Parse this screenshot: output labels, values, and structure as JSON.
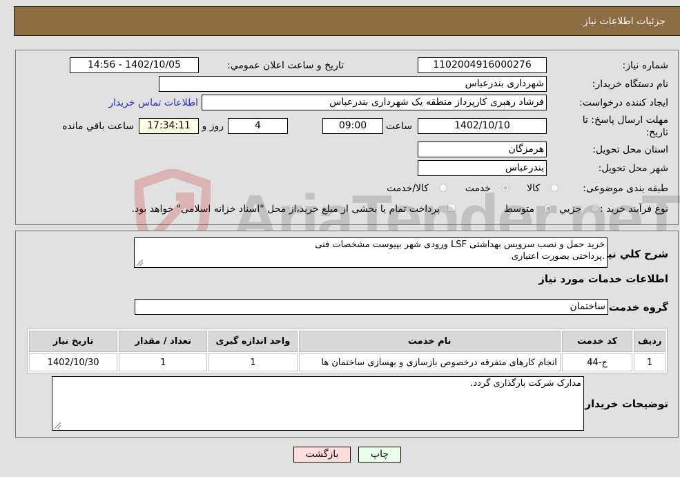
{
  "header": {
    "title": "جزئیات اطلاعات نیاز"
  },
  "form": {
    "need_number": {
      "label": "شماره نیاز:",
      "value": "1102004916000276"
    },
    "announce_datetime": {
      "label": "تاریخ و ساعت اعلان عمومي:",
      "value": "1402/10/05 - 14:56"
    },
    "buyer_org": {
      "label": "نام دستگاه خریدار:",
      "value": "شهرداری بندرعباس"
    },
    "requester": {
      "label": "ایجاد کننده درخواست:",
      "value": "فرشاد رهبری کارپرداز منطقه یک شهرداری بندرعباس"
    },
    "buyer_contact_link": "اطلاعات تماس خریدار",
    "deadline": {
      "label_line1": "مهلت ارسال پاسخ: تا",
      "label_line2": "تاریخ:",
      "date": "1402/10/10",
      "time_label": "ساعت",
      "time": "09:00",
      "days": "4",
      "days_label": "روز و",
      "remaining": "17:34:11",
      "remaining_label": "ساعت باقي مانده"
    },
    "delivery_province": {
      "label": "استان محل تحویل:",
      "value": "هرمزگان"
    },
    "delivery_city": {
      "label": "شهر محل تحویل:",
      "value": "بندرعباس"
    },
    "category": {
      "label": "طبقه بندی موضوعی:",
      "options": [
        "کالا",
        "خدمت",
        "کالا/خدمت"
      ],
      "selected": "خدمت"
    },
    "purchase_type": {
      "label": "نوع فرآیند خرید :",
      "options": [
        "جزیي",
        "متوسط"
      ],
      "selected": "متوسط",
      "treasury_checkbox_label": "پرداخت تمام یا بخشی از مبلغ خرید،از محل \"اسناد خزانه اسلامی\" خواهد بود.",
      "treasury_checked": false
    }
  },
  "description": {
    "label": "شرح کلي نیاز:",
    "value_line1": "خرید حمل و نصب سرویس بهداشتی LSF  ورودی شهر  بپیوست مشخصات فنی",
    "value_line2": ".پرداختی بصورت اعتباری"
  },
  "services": {
    "section_title": "اطلاعات خدمات مورد نیاز",
    "group_label": "گروه خدمت:",
    "group_value": "ساختمان",
    "table": {
      "columns": [
        "ردیف",
        "کد خدمت",
        "نام خدمت",
        "واحد اندازه گیری",
        "تعداد / مقدار",
        "تاریخ نیاز"
      ],
      "rows": [
        [
          "1",
          "ج-44",
          "انجام کارهای متفرقه درخصوص بازسازی و بهسازی ساختمان ها",
          "1",
          "1",
          "1402/10/30"
        ]
      ]
    }
  },
  "buyer_notes": {
    "label": "توضیحات خریدار:",
    "value": "مدارک شرکت بارگذاری گردد."
  },
  "buttons": {
    "print": "چاپ",
    "back": "بازگشت"
  },
  "colors": {
    "header_bg": "#8e6d42",
    "print_bg": "#eaffea",
    "back_bg": "#ffdede",
    "link": "#2a2ad0"
  },
  "watermark": {
    "text": "AriaTender.neT"
  }
}
